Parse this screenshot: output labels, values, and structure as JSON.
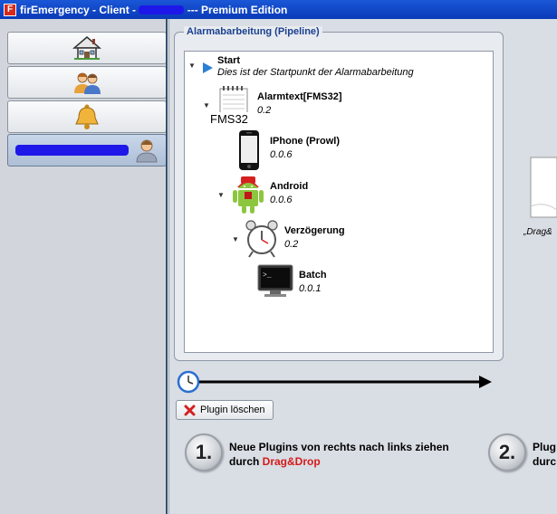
{
  "window": {
    "icon_letter": "F",
    "title_prefix": "firEmergency - Client - ",
    "title_suffix": " --- Premium Edition"
  },
  "sidebar": {
    "items": [
      {
        "id": "home",
        "icon": "house-icon"
      },
      {
        "id": "users",
        "icon": "users-icon"
      },
      {
        "id": "alarm",
        "icon": "bell-icon"
      },
      {
        "id": "account",
        "icon": "user-icon",
        "active": true
      }
    ]
  },
  "pipeline": {
    "title": "Alarmabarbeitung (Pipeline)",
    "nodes": [
      {
        "name": "Start",
        "desc": "Dies ist der Startpunkt der Alarmabarbeitung",
        "icon": "play-icon"
      },
      {
        "name": "Alarmtext[FMS32]",
        "desc": "0.2",
        "icon": "notepad-icon",
        "icon_caption": "FMS32"
      },
      {
        "name": "IPhone (Prowl)",
        "desc": "0.0.6",
        "icon": "iphone-icon"
      },
      {
        "name": "Android",
        "desc": "0.0.6",
        "icon": "android-icon"
      },
      {
        "name": "Verzögerung",
        "desc": "0.2",
        "icon": "alarm-clock-icon"
      },
      {
        "name": "Batch",
        "desc": "0.0.1",
        "icon": "terminal-icon"
      }
    ]
  },
  "actions": {
    "delete_plugin": "Plugin löschen"
  },
  "steps": [
    {
      "number": "1.",
      "line1": "Neue Plugins von rechts nach links ziehen",
      "line2_prefix": "durch ",
      "line2_highlight": "Drag&Drop"
    },
    {
      "number": "2.",
      "line1": "Plug",
      "line2_prefix": "durc",
      "line2_highlight": ""
    }
  ],
  "drop_target": {
    "caption": "„Drag&"
  },
  "colors": {
    "titlebar": "#0a3ab8",
    "group_title": "#1a3f8f",
    "highlight": "#d51a1a",
    "redaction": "#1d18e8"
  }
}
